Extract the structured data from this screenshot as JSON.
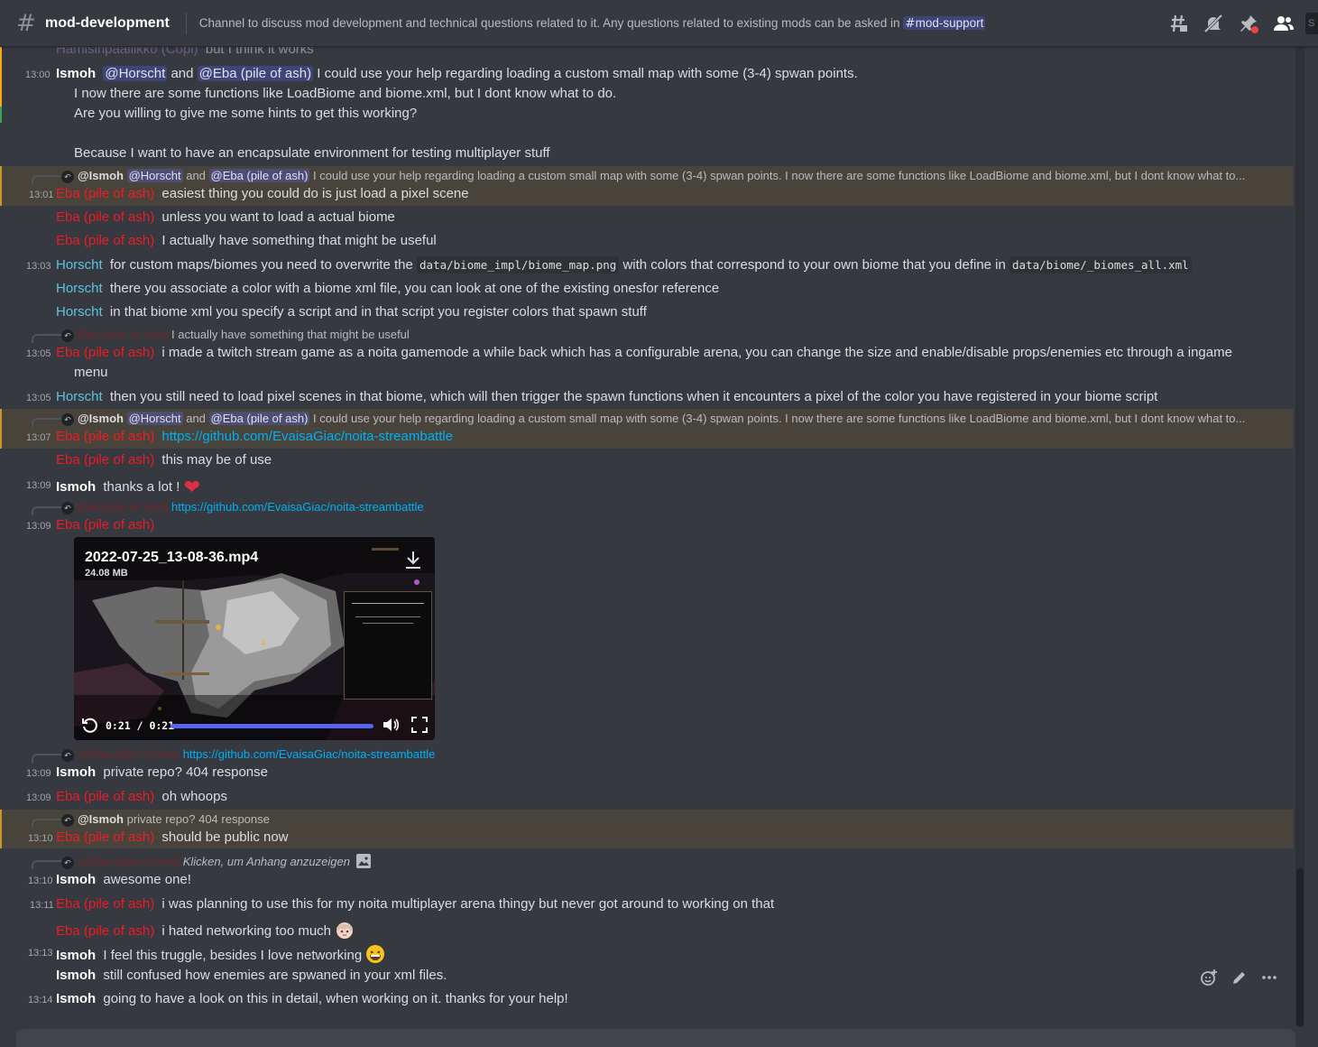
{
  "header": {
    "channel": "mod-development",
    "topic_text": "Channel to discuss mod development and technical questions related to it. Any questions related to existing mods can be asked in",
    "topic_channel": "mod-support",
    "search_stub": "S"
  },
  "messages": {
    "m0": {
      "user": "Hamisinpaallikko (Copi)",
      "text": "but I think it works"
    },
    "m1": {
      "time": "13:00",
      "user": "Ismoh",
      "mention1": "@Horscht",
      "and": "and",
      "mention2": "@Eba (pile of ash)",
      "text": "I could use your help regarding loading a custom small map with some (3-4) spwan points.",
      "line2": "I now there are some functions like LoadBiome and biome.xml, but I dont know what to do.",
      "line3": "Are you willing to give me some hints to get this working?",
      "line4": "Because I want to have an encapsulate environment for testing multiplayer stuff"
    },
    "r1": {
      "name": "@Ismoh",
      "m1": "@Horscht",
      "and": "and",
      "m2": "@Eba (pile of ash)",
      "text": "I could use your help regarding loading a custom small map with some (3-4) spwan points. I now there are some functions like LoadBiome and biome.xml, but I dont know what to..."
    },
    "m2": {
      "time": "13:01",
      "user": "Eba (pile of ash)",
      "text": "easiest thing you could do is just load a pixel scene"
    },
    "m3": {
      "user": "Eba (pile of ash)",
      "text": "unless you want to load a actual biome"
    },
    "m4": {
      "user": "Eba (pile of ash)",
      "text": "I actually have something that might be useful"
    },
    "m5": {
      "time": "13:03",
      "user": "Horscht",
      "t1": "for custom maps/biomes you need to overwrite the",
      "code1": "data/biome_impl/biome_map.png",
      "t2": "with colors that correspond to your own biome that you define in",
      "code2": "data/biome/_biomes_all.xml"
    },
    "m6": {
      "user": "Horscht",
      "text": "there you associate a color with a biome xml file, you can look at one of the existing onesfor reference"
    },
    "m7": {
      "user": "Horscht",
      "text": "in that biome xml you specify a script and in that script you register colors that spawn stuff"
    },
    "r2": {
      "name": "Eba (pile of ash)",
      "text": "I actually have something that might be useful"
    },
    "m8": {
      "time": "13:05",
      "user": "Eba (pile of ash)",
      "text": "i made a twitch stream game as a noita gamemode a while back which has a configurable arena, you can change the size and enable/disable props/enemies etc through a ingame",
      "line2": "menu"
    },
    "m9": {
      "time": "13:05",
      "user": "Horscht",
      "text": "then you still need to load pixel scenes in that biome, which will then trigger the spawn functions when it encounters a pixel of the color you have registered in your biome script"
    },
    "r3": {
      "name": "@Ismoh",
      "m1": "@Horscht",
      "and": "and",
      "m2": "@Eba (pile of ash)",
      "text": "I could use your help regarding loading a custom small map with some (3-4) spwan points. I now there are some functions like LoadBiome and biome.xml, but I dont know what to..."
    },
    "m10": {
      "time": "13:07",
      "user": "Eba (pile of ash)",
      "link": "https://github.com/EvaisaGiac/noita-streambattle"
    },
    "m11": {
      "user": "Eba (pile of ash)",
      "text": "this may be of use"
    },
    "m12": {
      "time": "13:09",
      "user": "Ismoh",
      "text": "thanks a lot !",
      "emoji": "❤"
    },
    "r4": {
      "name": "Eba (pile of ash)",
      "link": "https://github.com/EvaisaGiac/noita-streambattle"
    },
    "m13": {
      "time": "13:09",
      "user": "Eba (pile of ash)"
    },
    "video": {
      "filename": "2022-07-25_13-08-36.mp4",
      "size": "24.08 MB",
      "time": "0:21 / 0:21",
      "progress": 1.0
    },
    "r5": {
      "name": "@Eba (pile of ash)",
      "link": "https://github.com/EvaisaGiac/noita-streambattle"
    },
    "m14": {
      "time": "13:09",
      "user": "Ismoh",
      "text": "private repo? 404 response"
    },
    "m15": {
      "time": "13:09",
      "user": "Eba (pile of ash)",
      "text": "oh whoops"
    },
    "r6": {
      "name": "@Ismoh",
      "text": "private repo? 404 response"
    },
    "m16": {
      "time": "13:10",
      "user": "Eba (pile of ash)",
      "text": "should be public now"
    },
    "r7": {
      "name": "@Eba (pile of ash)",
      "text": "Klicken, um Anhang anzuzeigen"
    },
    "m17": {
      "time": "13:10",
      "user": "Ismoh",
      "text": "awesome one!"
    },
    "m18": {
      "time": "13:11",
      "user": "Eba (pile of ash)",
      "text": "i was planning to use this for my noita multiplayer arena thingy but never got around to working on that"
    },
    "m19": {
      "user": "Eba (pile of ash)",
      "text": "i hated networking too much"
    },
    "m20": {
      "time": "13:13",
      "user": "Ismoh",
      "text": "I feel this truggle, besides I love networking",
      "emoji": "😄"
    },
    "m21": {
      "user": "Ismoh",
      "text": "still confused how enemies are spwaned in your xml files."
    },
    "m22": {
      "time": "13:14",
      "user": "Ismoh",
      "text": "going to have a look on this in detail, when working on it. thanks for your help!"
    }
  },
  "colors": {
    "background": "#36393f",
    "eba": "#ed1c24",
    "horscht": "#5ec4e0",
    "link": "#00aff4",
    "highlight": "#c9962a"
  }
}
